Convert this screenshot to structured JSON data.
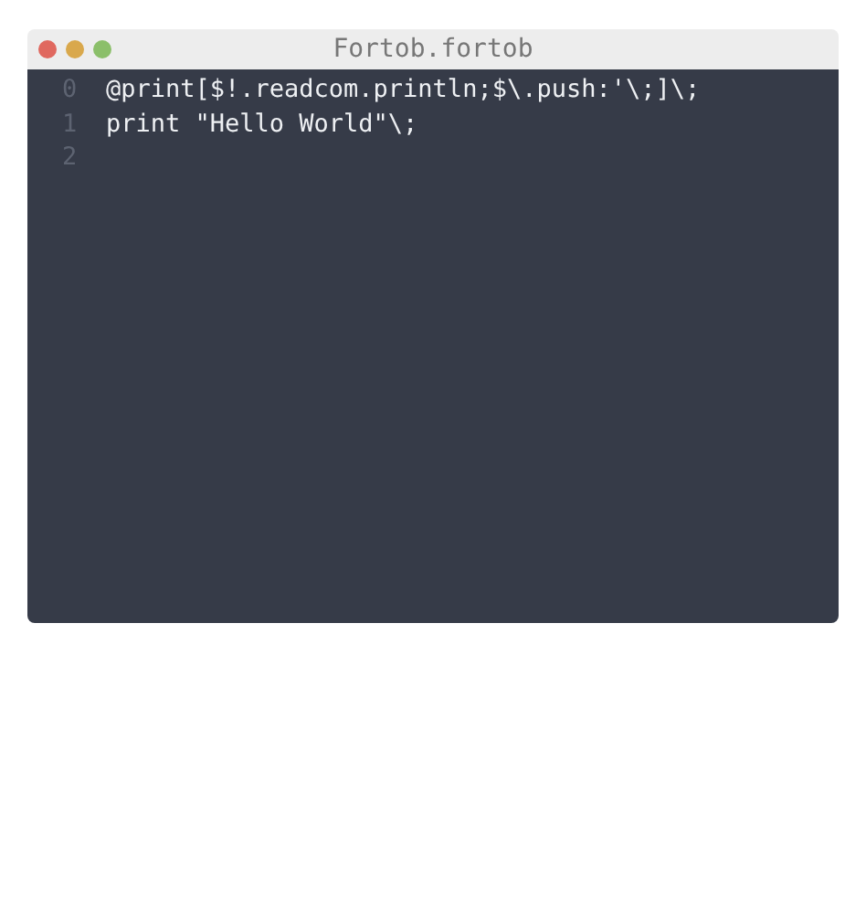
{
  "window": {
    "title": "Fortob.fortob"
  },
  "editor": {
    "lines": [
      {
        "number": "0",
        "code": "@print[$!.readcom.println;$\\.push:'\\;]\\;"
      },
      {
        "number": "1",
        "code": "print \"Hello World\"\\;"
      },
      {
        "number": "2"
      }
    ]
  }
}
